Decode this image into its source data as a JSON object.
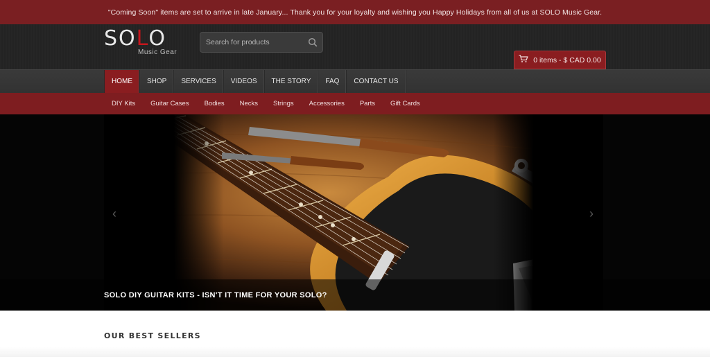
{
  "announcement": "\"Coming Soon\" items are set to arrive in late January... Thank you for your loyalty and wishing you Happy Holidays from all of us at SOLO Music Gear.",
  "brand": {
    "logo_letters": [
      "S",
      "O",
      "L",
      "O"
    ],
    "tagline": "Music Gear",
    "accent": "#c4161c"
  },
  "search": {
    "placeholder": "Search for products",
    "icon": "search-icon"
  },
  "cart": {
    "label": "0 items - $ CAD 0.00",
    "icon": "cart-icon"
  },
  "main_nav": [
    {
      "label": "HOME",
      "active": true
    },
    {
      "label": "SHOP"
    },
    {
      "label": "SERVICES"
    },
    {
      "label": "VIDEOS"
    },
    {
      "label": "THE STORY"
    },
    {
      "label": "FAQ"
    },
    {
      "label": "CONTACT US"
    }
  ],
  "sub_nav": [
    "DIY Kits",
    "Guitar Cases",
    "Bodies",
    "Necks",
    "Strings",
    "Accessories",
    "Parts",
    "Gift Cards"
  ],
  "hero": {
    "caption": "SOLO DIY GUITAR KITS - ISN'T IT TIME FOR YOUR SOLO?",
    "prev_icon": "chevron-left-icon",
    "next_icon": "chevron-right-icon"
  },
  "section_title": "OUR BEST SELLERS",
  "colors": {
    "announce_bg": "#7a1f22",
    "nav_active": "#8a1d20",
    "subnav_bg": "#7e1d20"
  }
}
